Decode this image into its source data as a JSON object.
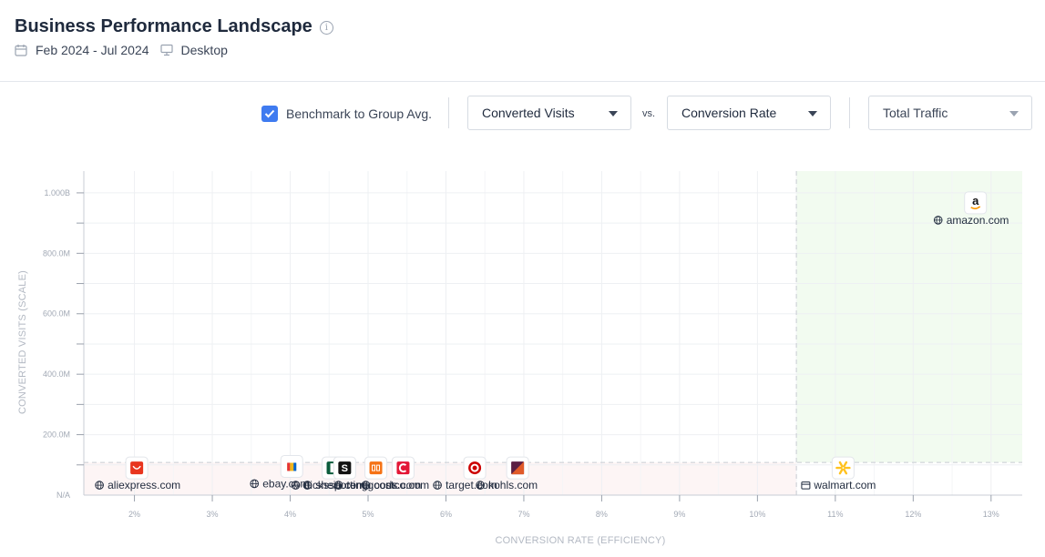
{
  "header": {
    "title": "Business Performance Landscape",
    "date_range": "Feb 2024 - Jul 2024",
    "device": "Desktop",
    "icons": {
      "info": "info-icon",
      "calendar": "calendar-icon",
      "device": "desktop-icon"
    }
  },
  "controls": {
    "benchmark_label": "Benchmark to Group Avg.",
    "benchmark_checked": true,
    "y_metric": "Converted Visits",
    "vs_label": "vs.",
    "x_metric": "Conversion Rate",
    "size_metric": "Total Traffic"
  },
  "colors": {
    "accent": "#3f7bf0",
    "top_right_quadrant": "#f2fbf0",
    "bottom_left_quadrant": "#fdf5f5"
  },
  "chart_data": {
    "type": "scatter",
    "xlabel": "CONVERSION RATE (EFFICIENCY)",
    "ylabel": "CONVERTED VISITS (SCALE)",
    "x_ticks": [
      "2%",
      "3%",
      "4%",
      "5%",
      "6%",
      "7%",
      "8%",
      "9%",
      "10%",
      "11%",
      "12%",
      "13%"
    ],
    "x_tick_values": [
      2,
      3,
      4,
      5,
      6,
      7,
      8,
      9,
      10,
      11,
      12,
      13
    ],
    "y_ticks": [
      "N/A",
      "200.0M",
      "400.0M",
      "600.0M",
      "800.0M",
      "1.000B"
    ],
    "y_tick_values": [
      0,
      200,
      400,
      600,
      800,
      1000
    ],
    "y_unit": "M",
    "xlim": [
      1.35,
      13.4
    ],
    "ylim": [
      0,
      1072
    ],
    "benchmark_x": 10.5,
    "benchmark_y": 108,
    "grid": true,
    "points": [
      {
        "label": "aliexpress.com",
        "x": 2.03,
        "y": 90,
        "logo": "aliexpress-logo",
        "show_label": true
      },
      {
        "label": "ebay.com",
        "x": 4.02,
        "y": 95,
        "logo": "ebay-logo",
        "show_label": true
      },
      {
        "label": "dickssportinggoods.com",
        "x": 4.55,
        "y": 90,
        "logo": "dicks-logo",
        "show_label": true
      },
      {
        "label": "shein.com",
        "x": 4.7,
        "y": 90,
        "logo": "shein-logo",
        "show_label": true
      },
      {
        "label": "temu.com",
        "x": 5.1,
        "y": 90,
        "logo": "temu-logo",
        "show_label": true
      },
      {
        "label": "costco.com",
        "x": 5.45,
        "y": 90,
        "logo": "costco-logo",
        "show_label": true
      },
      {
        "label": "target.com",
        "x": 6.37,
        "y": 90,
        "logo": "target-logo",
        "show_label": true
      },
      {
        "label": "kohls.com",
        "x": 6.92,
        "y": 90,
        "logo": "kohls-logo",
        "show_label": true
      },
      {
        "label": "walmart.com",
        "x": 11.1,
        "y": 90,
        "logo": "walmart-logo",
        "show_label": true
      },
      {
        "label": "amazon.com",
        "x": 12.8,
        "y": 967,
        "logo": "amazon-logo",
        "show_label": true
      }
    ]
  }
}
